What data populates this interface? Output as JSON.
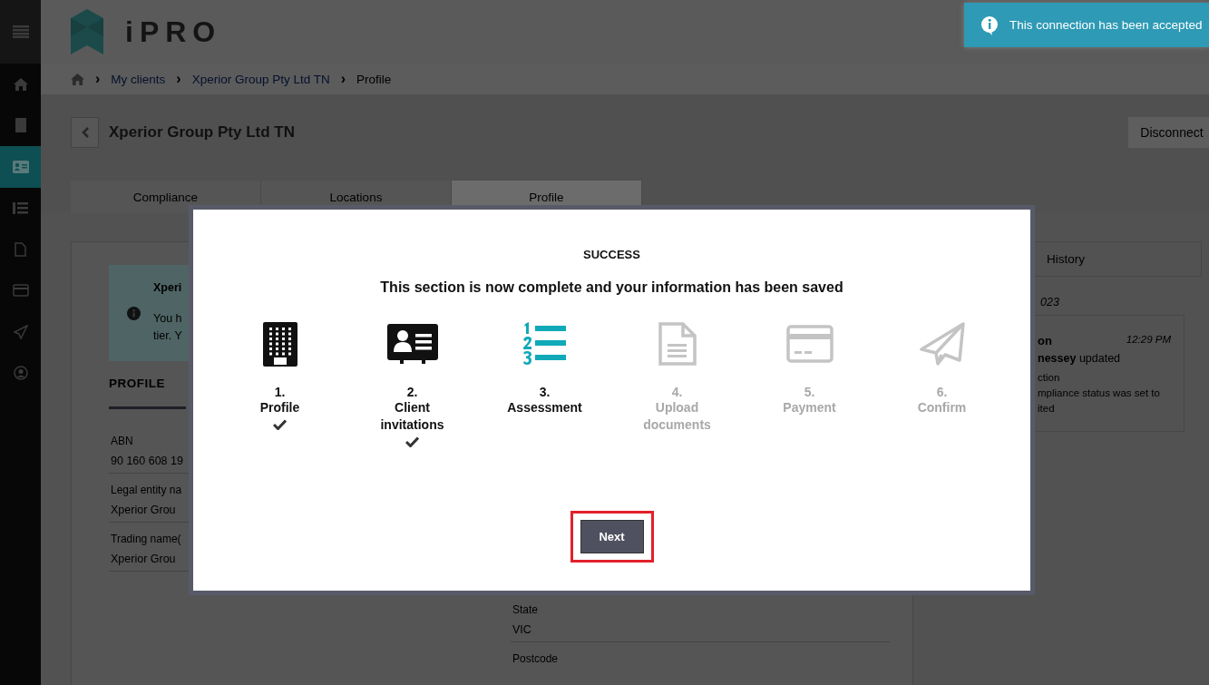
{
  "sidebar": {
    "items": [
      {
        "selected": false
      },
      {
        "selected": false
      },
      {
        "selected": true
      },
      {
        "selected": false
      },
      {
        "selected": false
      },
      {
        "selected": false
      },
      {
        "selected": false
      },
      {
        "selected": false
      }
    ]
  },
  "app": {
    "logo_text": "iPRO"
  },
  "toast": {
    "message": "This connection has been accepted"
  },
  "breadcrumb": [
    {
      "separator": "›",
      "label": "My clients",
      "kind": "link"
    },
    {
      "separator": "›",
      "label": "Xperior Group Pty Ltd TN",
      "kind": "link"
    },
    {
      "separator": "›",
      "label": "Profile",
      "kind": "current"
    }
  ],
  "page": {
    "title": "Xperior Group Pty Ltd TN",
    "disconnect_button": "Disconnect"
  },
  "tabs": [
    {
      "label": "Compliance",
      "selected": false
    },
    {
      "label": "Locations",
      "selected": false
    },
    {
      "label": "Profile",
      "selected": true
    }
  ],
  "notice": {
    "title": "Xperi",
    "lines": [
      "You h",
      "tier. Y"
    ]
  },
  "profile": {
    "heading": "PROFILE",
    "fields": [
      {
        "label": "ABN",
        "value": "90 160 608 19"
      },
      {
        "label": "Legal entity na",
        "value": "Xperior Grou"
      },
      {
        "label": "Trading name(",
        "value": "Xperior Grou"
      }
    ]
  },
  "address_fields": [
    {
      "label": "State",
      "value": "VIC"
    },
    {
      "label": "Postcode"
    }
  ],
  "history": {
    "tab": "History",
    "date": "023",
    "entry": {
      "title": "on",
      "time": "12:29 PM",
      "actor_line": "**nessey** updated",
      "lines": [
        "ction",
        "mpliance status was set to",
        "ited"
      ]
    }
  },
  "modal": {
    "title": "SUCCESS",
    "message": "This section is now complete and your information has been saved",
    "steps": [
      {
        "number": "1.",
        "label": "Profile",
        "completed": true,
        "active": false
      },
      {
        "number": "2.",
        "label": "Client invitations",
        "completed": true,
        "active": false
      },
      {
        "number": "3.",
        "label": "Assessment",
        "completed": false,
        "active": true
      },
      {
        "number": "4.",
        "label": "Upload documents",
        "completed": false,
        "active": false
      },
      {
        "number": "5.",
        "label": "Payment",
        "completed": false,
        "active": false
      },
      {
        "number": "6.",
        "label": "Confirm",
        "completed": false,
        "active": false
      }
    ],
    "next_button": {
      "label": "Next",
      "highlighted": true
    }
  }
}
